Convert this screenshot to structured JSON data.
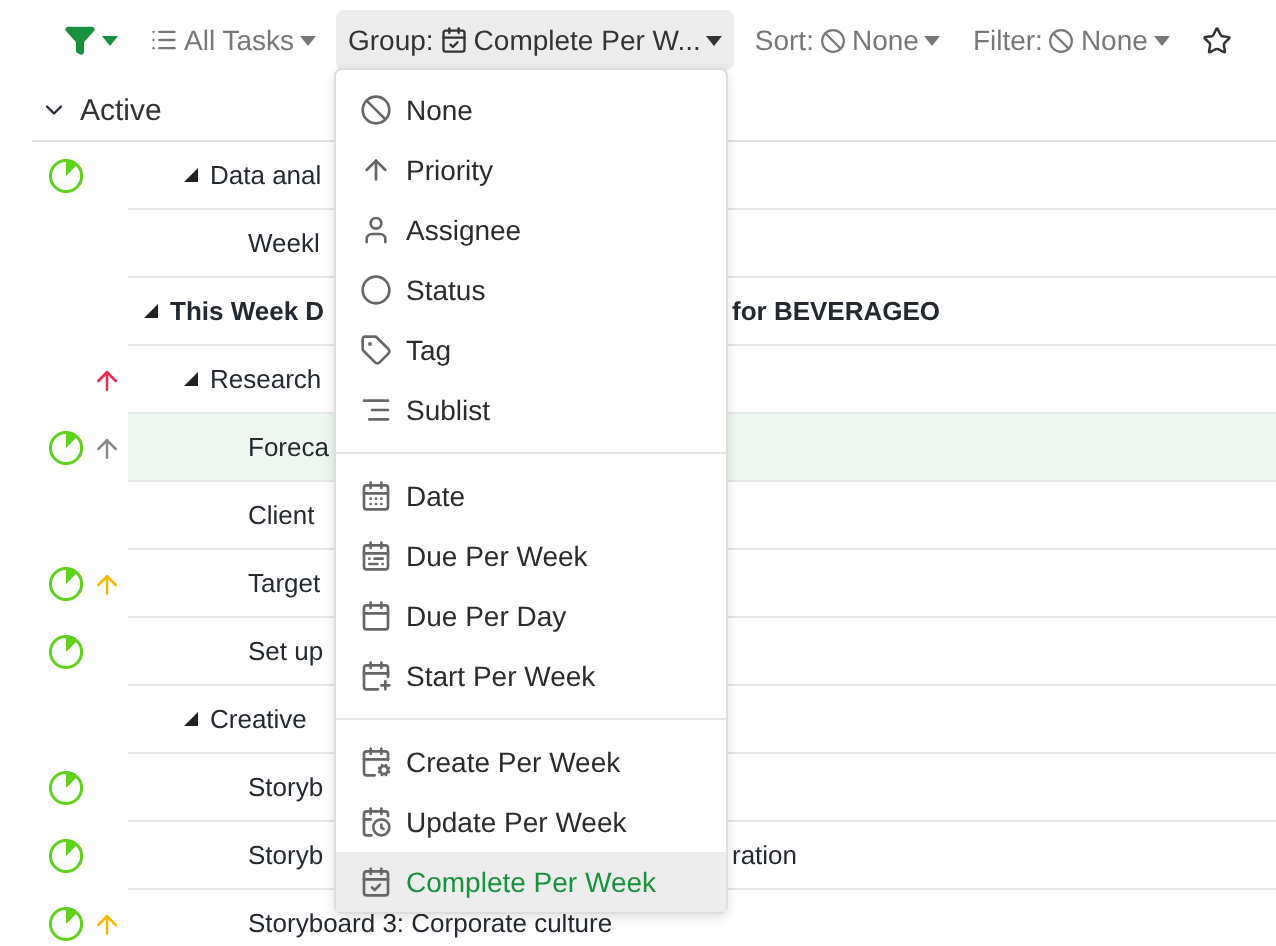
{
  "toolbar": {
    "view": "All Tasks",
    "group": {
      "label": "Group:",
      "value": "Complete Per W...",
      "open": true
    },
    "sort": {
      "label": "Sort:",
      "value": "None"
    },
    "filter": {
      "label": "Filter:",
      "value": "None"
    }
  },
  "section": {
    "title": "Active",
    "expanded": true
  },
  "rows": [
    {
      "kind": "list",
      "title": "Data anal",
      "expanded": true,
      "started": true,
      "selected": false,
      "children": [
        {
          "kind": "task",
          "title": "Weekl",
          "started": false,
          "selected": false
        }
      ]
    },
    {
      "kind": "group",
      "title": "This Week D",
      "tail": "for BEVERAGEO",
      "expanded": true,
      "started": false,
      "selected": false,
      "children": [
        {
          "kind": "list",
          "title": "Research",
          "expanded": true,
          "started": false,
          "color": "#ee2a4b",
          "selected": false,
          "children": [
            {
              "kind": "task",
              "title": "Foreca",
              "started": true,
              "color": "#8a8a8a",
              "selected": true
            },
            {
              "kind": "task",
              "title": "Client",
              "started": false,
              "selected": false
            },
            {
              "kind": "task",
              "title": "Target",
              "started": true,
              "color": "#f5b800",
              "selected": false
            },
            {
              "kind": "task",
              "title": "Set up",
              "started": true,
              "selected": false
            }
          ]
        },
        {
          "kind": "list",
          "title": "Creative",
          "expanded": true,
          "started": false,
          "selected": false,
          "children": [
            {
              "kind": "task",
              "title": "Storyb",
              "started": true,
              "selected": false
            },
            {
              "kind": "task",
              "title": "Storyb",
              "tail": "ration",
              "started": true,
              "selected": false
            },
            {
              "kind": "task",
              "title": "Storyboard 3: Corporate culture",
              "started": true,
              "color": "#f5b800",
              "selected": false
            }
          ]
        }
      ]
    }
  ],
  "menu": {
    "sections": [
      [
        {
          "label": "None",
          "selected": false
        },
        {
          "label": "Priority",
          "selected": false
        },
        {
          "label": "Assignee",
          "selected": false
        },
        {
          "label": "Status",
          "selected": false
        },
        {
          "label": "Tag",
          "selected": false
        },
        {
          "label": "Sublist",
          "selected": false
        }
      ],
      [
        {
          "label": "Date",
          "selected": false
        },
        {
          "label": "Due Per Week",
          "selected": false
        },
        {
          "label": "Due Per Day",
          "selected": false
        },
        {
          "label": "Start Per Week",
          "selected": false
        }
      ],
      [
        {
          "label": "Create Per Week",
          "selected": false
        },
        {
          "label": "Update Per Week",
          "selected": false
        },
        {
          "label": "Complete Per Week",
          "selected": true
        }
      ]
    ]
  }
}
